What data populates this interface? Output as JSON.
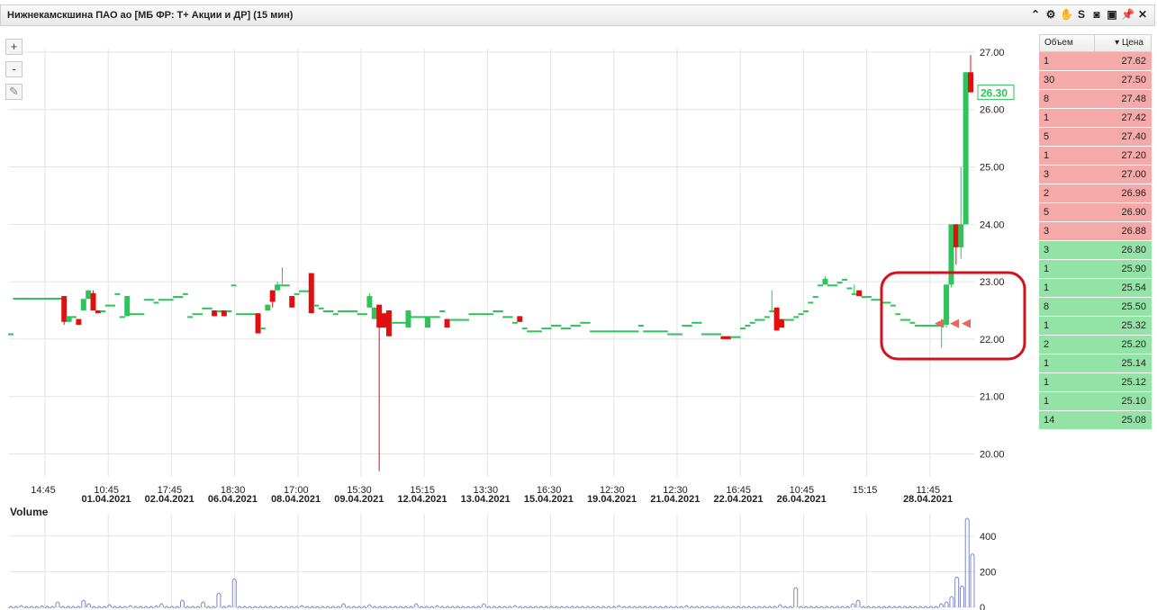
{
  "window": {
    "title": "Нижнекамскшина ПАО ао [МБ ФР: Т+ Акции и ДР] (15 мин)",
    "icons": [
      "chevron-up-icon",
      "gear-icon",
      "hand-icon",
      "s-icon",
      "camera-icon",
      "window-icon",
      "pin-icon",
      "close-icon"
    ]
  },
  "toolbar": {
    "zoom_in": "+",
    "zoom_out": "-",
    "pencil": "✎"
  },
  "chart_data": {
    "type": "candlestick",
    "title": "Нижнекамскшина ПАО ао [МБ ФР: Т+ Акции и ДР] (15 мин)",
    "ylim": [
      19.6,
      27.25
    ],
    "y_ticks": [
      "27.00",
      "26.00",
      "25.00",
      "24.00",
      "23.00",
      "22.00",
      "21.00",
      "20.00"
    ],
    "last_price": "26.30",
    "x_time_labels": [
      "14:45",
      "10:45",
      "17:45",
      "18:30",
      "17:00",
      "15:30",
      "15:15",
      "13:30",
      "16:30",
      "12:30",
      "12:30",
      "16:45",
      "10:45",
      "15:15",
      "11:45"
    ],
    "x_date_labels": [
      "01.04.2021",
      "02.04.2021",
      "06.04.2021",
      "08.04.2021",
      "09.04.2021",
      "12.04.2021",
      "13.04.2021",
      "15.04.2021",
      "19.04.2021",
      "21.04.2021",
      "22.04.2021",
      "26.04.2021",
      "28.04.2021"
    ],
    "candles_ohlc": [
      [
        22.1,
        22.1,
        22.1,
        22.1
      ],
      [
        22.7,
        22.72,
        22.7,
        22.72
      ],
      [
        22.72,
        22.72,
        22.72,
        22.72
      ],
      [
        22.72,
        22.72,
        22.72,
        22.72
      ],
      [
        22.72,
        22.72,
        22.72,
        22.72
      ],
      [
        22.72,
        22.72,
        22.72,
        22.72
      ],
      [
        22.72,
        22.72,
        22.72,
        22.72
      ],
      [
        22.72,
        22.72,
        22.72,
        22.72
      ],
      [
        22.72,
        22.72,
        22.72,
        22.72
      ],
      [
        22.72,
        22.72,
        22.72,
        22.72
      ],
      [
        22.72,
        22.72,
        22.72,
        22.72
      ],
      [
        22.75,
        22.75,
        22.25,
        22.3
      ],
      [
        22.3,
        22.4,
        22.3,
        22.4
      ],
      [
        22.4,
        22.4,
        22.4,
        22.4
      ],
      [
        22.35,
        22.35,
        22.25,
        22.25
      ],
      [
        22.5,
        22.7,
        22.5,
        22.7
      ],
      [
        22.7,
        22.85,
        22.7,
        22.85
      ],
      [
        22.8,
        22.85,
        22.5,
        22.5
      ],
      [
        22.5,
        22.5,
        22.45,
        22.45
      ],
      [
        22.5,
        22.5,
        22.5,
        22.5
      ],
      [
        22.6,
        22.6,
        22.6,
        22.6
      ],
      [
        22.6,
        22.6,
        22.6,
        22.6
      ],
      [
        22.8,
        22.8,
        22.8,
        22.8
      ],
      [
        22.4,
        22.4,
        22.4,
        22.4
      ],
      [
        22.4,
        22.75,
        22.4,
        22.75
      ],
      [
        22.45,
        22.45,
        22.45,
        22.45
      ],
      [
        22.45,
        22.45,
        22.45,
        22.45
      ],
      [
        22.45,
        22.45,
        22.45,
        22.45
      ],
      [
        22.7,
        22.7,
        22.7,
        22.7
      ],
      [
        22.7,
        22.7,
        22.7,
        22.7
      ],
      [
        22.65,
        22.65,
        22.65,
        22.65
      ],
      [
        22.7,
        22.7,
        22.7,
        22.7
      ],
      [
        22.7,
        22.7,
        22.7,
        22.7
      ],
      [
        22.7,
        22.7,
        22.7,
        22.7
      ],
      [
        22.75,
        22.75,
        22.75,
        22.75
      ],
      [
        22.75,
        22.75,
        22.75,
        22.75
      ],
      [
        22.8,
        22.8,
        22.8,
        22.8
      ],
      [
        22.4,
        22.4,
        22.4,
        22.4
      ],
      [
        22.45,
        22.45,
        22.45,
        22.45
      ],
      [
        22.45,
        22.45,
        22.45,
        22.45
      ],
      [
        22.55,
        22.55,
        22.55,
        22.55
      ],
      [
        22.55,
        22.55,
        22.55,
        22.55
      ],
      [
        22.5,
        22.5,
        22.4,
        22.4
      ],
      [
        22.5,
        22.5,
        22.5,
        22.5
      ],
      [
        22.5,
        22.5,
        22.4,
        22.4
      ],
      [
        22.5,
        22.5,
        22.5,
        22.5
      ],
      [
        22.95,
        22.95,
        22.95,
        22.95
      ],
      [
        22.45,
        22.45,
        22.45,
        22.45
      ],
      [
        22.45,
        22.45,
        22.45,
        22.45
      ],
      [
        22.45,
        22.45,
        22.45,
        22.45
      ],
      [
        22.45,
        22.45,
        22.45,
        22.45
      ],
      [
        22.45,
        22.45,
        22.1,
        22.1
      ],
      [
        22.2,
        22.2,
        22.2,
        22.2
      ],
      [
        22.5,
        22.6,
        22.5,
        22.6
      ],
      [
        22.85,
        22.85,
        22.55,
        22.65
      ],
      [
        22.85,
        23.0,
        22.85,
        22.95
      ],
      [
        22.95,
        23.25,
        22.95,
        22.95
      ],
      [
        22.95,
        22.95,
        22.95,
        22.95
      ],
      [
        22.75,
        22.75,
        22.55,
        22.55
      ],
      [
        22.8,
        22.8,
        22.8,
        22.8
      ],
      [
        22.85,
        22.85,
        22.85,
        22.85
      ],
      [
        22.85,
        22.85,
        22.85,
        22.85
      ],
      [
        23.15,
        23.15,
        22.45,
        22.45
      ],
      [
        22.6,
        22.6,
        22.6,
        22.6
      ],
      [
        22.55,
        22.55,
        22.55,
        22.55
      ],
      [
        22.5,
        22.5,
        22.5,
        22.5
      ],
      [
        22.5,
        22.5,
        22.5,
        22.5
      ],
      [
        22.45,
        22.45,
        22.45,
        22.45
      ],
      [
        22.5,
        22.5,
        22.5,
        22.5
      ],
      [
        22.5,
        22.5,
        22.5,
        22.5
      ],
      [
        22.5,
        22.5,
        22.5,
        22.5
      ],
      [
        22.5,
        22.5,
        22.5,
        22.5
      ],
      [
        22.45,
        22.45,
        22.45,
        22.45
      ],
      [
        22.45,
        22.45,
        22.45,
        22.45
      ],
      [
        22.55,
        22.8,
        22.55,
        22.75
      ],
      [
        22.35,
        22.55,
        22.35,
        22.55
      ],
      [
        22.6,
        22.6,
        19.7,
        22.2
      ],
      [
        22.45,
        22.45,
        22.2,
        22.2
      ],
      [
        22.5,
        22.5,
        22.05,
        22.05
      ],
      [
        22.3,
        22.3,
        22.3,
        22.3
      ],
      [
        22.3,
        22.3,
        22.3,
        22.3
      ],
      [
        22.3,
        22.3,
        22.3,
        22.3
      ],
      [
        22.2,
        22.5,
        22.2,
        22.5
      ],
      [
        22.4,
        22.4,
        22.4,
        22.4
      ],
      [
        22.4,
        22.4,
        22.4,
        22.4
      ],
      [
        22.4,
        22.4,
        22.4,
        22.4
      ],
      [
        22.2,
        22.4,
        22.2,
        22.4
      ],
      [
        22.4,
        22.4,
        22.4,
        22.4
      ],
      [
        22.4,
        22.4,
        22.4,
        22.4
      ],
      [
        22.5,
        22.5,
        22.5,
        22.5
      ],
      [
        22.35,
        22.35,
        22.2,
        22.2
      ],
      [
        22.35,
        22.35,
        22.35,
        22.35
      ],
      [
        22.35,
        22.35,
        22.35,
        22.35
      ],
      [
        22.35,
        22.35,
        22.35,
        22.35
      ],
      [
        22.35,
        22.35,
        22.35,
        22.35
      ],
      [
        22.45,
        22.45,
        22.45,
        22.45
      ],
      [
        22.45,
        22.45,
        22.45,
        22.45
      ],
      [
        22.45,
        22.45,
        22.45,
        22.45
      ],
      [
        22.45,
        22.45,
        22.45,
        22.45
      ],
      [
        22.45,
        22.45,
        22.45,
        22.45
      ],
      [
        22.5,
        22.5,
        22.5,
        22.5
      ],
      [
        22.5,
        22.5,
        22.5,
        22.5
      ],
      [
        22.4,
        22.4,
        22.4,
        22.4
      ],
      [
        22.4,
        22.4,
        22.4,
        22.4
      ],
      [
        22.3,
        22.3,
        22.3,
        22.3
      ],
      [
        22.4,
        22.4,
        22.3,
        22.3
      ],
      [
        22.2,
        22.2,
        22.2,
        22.2
      ],
      [
        22.15,
        22.15,
        22.15,
        22.15
      ],
      [
        22.15,
        22.15,
        22.15,
        22.15
      ],
      [
        22.15,
        22.15,
        22.15,
        22.15
      ],
      [
        22.2,
        22.2,
        22.2,
        22.2
      ],
      [
        22.2,
        22.2,
        22.2,
        22.2
      ],
      [
        22.25,
        22.25,
        22.25,
        22.25
      ],
      [
        22.25,
        22.25,
        22.25,
        22.25
      ],
      [
        22.2,
        22.2,
        22.2,
        22.2
      ],
      [
        22.2,
        22.2,
        22.2,
        22.2
      ],
      [
        22.25,
        22.25,
        22.25,
        22.25
      ],
      [
        22.25,
        22.25,
        22.25,
        22.25
      ],
      [
        22.3,
        22.3,
        22.3,
        22.3
      ],
      [
        22.3,
        22.3,
        22.3,
        22.3
      ],
      [
        22.15,
        22.15,
        22.15,
        22.15
      ],
      [
        22.15,
        22.15,
        22.15,
        22.15
      ],
      [
        22.15,
        22.15,
        22.15,
        22.15
      ],
      [
        22.15,
        22.15,
        22.15,
        22.15
      ],
      [
        22.15,
        22.15,
        22.15,
        22.15
      ],
      [
        22.15,
        22.15,
        22.15,
        22.15
      ],
      [
        22.15,
        22.15,
        22.15,
        22.15
      ],
      [
        22.15,
        22.15,
        22.15,
        22.15
      ],
      [
        22.15,
        22.15,
        22.15,
        22.15
      ],
      [
        22.15,
        22.15,
        22.15,
        22.15
      ],
      [
        22.25,
        22.25,
        22.25,
        22.25
      ],
      [
        22.15,
        22.15,
        22.15,
        22.15
      ],
      [
        22.15,
        22.15,
        22.15,
        22.15
      ],
      [
        22.15,
        22.15,
        22.15,
        22.15
      ],
      [
        22.15,
        22.15,
        22.15,
        22.15
      ],
      [
        22.15,
        22.15,
        22.15,
        22.15
      ],
      [
        22.1,
        22.1,
        22.1,
        22.1
      ],
      [
        22.1,
        22.1,
        22.1,
        22.1
      ],
      [
        22.1,
        22.1,
        22.1,
        22.1
      ],
      [
        22.25,
        22.25,
        22.25,
        22.25
      ],
      [
        22.25,
        22.25,
        22.25,
        22.25
      ],
      [
        22.3,
        22.3,
        22.3,
        22.3
      ],
      [
        22.3,
        22.3,
        22.3,
        22.3
      ],
      [
        22.1,
        22.1,
        22.1,
        22.1
      ],
      [
        22.1,
        22.1,
        22.1,
        22.1
      ],
      [
        22.1,
        22.1,
        22.1,
        22.1
      ],
      [
        22.1,
        22.1,
        22.1,
        22.1
      ],
      [
        22.05,
        22.05,
        22.0,
        22.0
      ],
      [
        22.05,
        22.05,
        22.0,
        22.0
      ],
      [
        22.05,
        22.05,
        22.05,
        22.05
      ],
      [
        22.05,
        22.05,
        22.05,
        22.05
      ],
      [
        22.2,
        22.2,
        22.2,
        22.2
      ],
      [
        22.25,
        22.25,
        22.25,
        22.25
      ],
      [
        22.3,
        22.3,
        22.3,
        22.3
      ],
      [
        22.35,
        22.35,
        22.35,
        22.35
      ],
      [
        22.35,
        22.35,
        22.35,
        22.35
      ],
      [
        22.4,
        22.4,
        22.4,
        22.4
      ],
      [
        22.5,
        22.85,
        22.5,
        22.5
      ],
      [
        22.55,
        22.55,
        22.15,
        22.15
      ],
      [
        22.35,
        22.35,
        22.2,
        22.2
      ],
      [
        22.35,
        22.35,
        22.35,
        22.35
      ],
      [
        22.35,
        22.35,
        22.35,
        22.35
      ],
      [
        22.4,
        22.4,
        22.4,
        22.4
      ],
      [
        22.45,
        22.45,
        22.45,
        22.45
      ],
      [
        22.5,
        22.5,
        22.5,
        22.5
      ],
      [
        22.65,
        22.65,
        22.65,
        22.65
      ],
      [
        22.75,
        22.75,
        22.75,
        22.75
      ],
      [
        22.95,
        22.95,
        22.95,
        22.95
      ],
      [
        22.95,
        23.1,
        22.95,
        23.05
      ],
      [
        22.95,
        22.95,
        22.95,
        22.95
      ],
      [
        22.95,
        22.95,
        22.95,
        22.95
      ],
      [
        23.0,
        23.0,
        23.0,
        23.0
      ],
      [
        23.05,
        23.05,
        23.05,
        23.05
      ],
      [
        22.9,
        22.9,
        22.9,
        22.9
      ],
      [
        22.8,
        22.95,
        22.8,
        22.8
      ],
      [
        22.85,
        22.85,
        22.75,
        22.75
      ],
      [
        22.75,
        22.75,
        22.75,
        22.75
      ],
      [
        22.75,
        22.75,
        22.75,
        22.75
      ],
      [
        22.7,
        22.7,
        22.7,
        22.7
      ],
      [
        22.7,
        22.7,
        22.7,
        22.7
      ],
      [
        22.65,
        22.65,
        22.65,
        22.65
      ],
      [
        22.65,
        22.65,
        22.65,
        22.65
      ],
      [
        22.6,
        22.6,
        22.6,
        22.6
      ],
      [
        22.45,
        22.45,
        22.45,
        22.45
      ],
      [
        22.35,
        22.35,
        22.35,
        22.35
      ],
      [
        22.35,
        22.35,
        22.35,
        22.35
      ],
      [
        22.3,
        22.3,
        22.3,
        22.3
      ],
      [
        22.25,
        22.25,
        22.25,
        22.25
      ],
      [
        22.25,
        22.25,
        22.25,
        22.25
      ],
      [
        22.25,
        22.25,
        22.25,
        22.25
      ],
      [
        22.25,
        22.25,
        22.25,
        22.25
      ],
      [
        22.25,
        22.25,
        22.25,
        22.25
      ],
      [
        22.25,
        22.35,
        21.85,
        22.25
      ],
      [
        22.25,
        22.95,
        22.2,
        22.95
      ],
      [
        22.95,
        24.0,
        22.9,
        24.0
      ],
      [
        24.0,
        24.0,
        23.3,
        23.6
      ],
      [
        23.6,
        25.0,
        23.4,
        24.0
      ],
      [
        24.0,
        26.65,
        24.0,
        26.65
      ],
      [
        26.65,
        26.95,
        26.3,
        26.3
      ]
    ],
    "volume_panel": {
      "title": "Volume",
      "y_ticks": [
        "400",
        "200",
        "0"
      ],
      "ylim": [
        0,
        500
      ]
    },
    "volumes": [
      5,
      5,
      10,
      5,
      5,
      5,
      8,
      5,
      5,
      30,
      5,
      5,
      5,
      5,
      40,
      20,
      5,
      5,
      5,
      15,
      5,
      5,
      5,
      10,
      5,
      5,
      5,
      5,
      8,
      20,
      5,
      5,
      5,
      40,
      5,
      5,
      5,
      30,
      5,
      5,
      80,
      5,
      10,
      160,
      5,
      5,
      5,
      5,
      5,
      5,
      5,
      5,
      5,
      5,
      5,
      5,
      10,
      5,
      5,
      5,
      5,
      5,
      5,
      5,
      20,
      5,
      5,
      5,
      5,
      15,
      5,
      5,
      5,
      5,
      5,
      5,
      5,
      5,
      20,
      5,
      5,
      5,
      10,
      5,
      5,
      5,
      5,
      5,
      5,
      5,
      5,
      20,
      5,
      5,
      5,
      5,
      5,
      10,
      5,
      5,
      5,
      5,
      5,
      5,
      5,
      5,
      5,
      5,
      5,
      5,
      5,
      5,
      5,
      5,
      5,
      5,
      5,
      10,
      5,
      5,
      5,
      5,
      5,
      5,
      5,
      5,
      5,
      5,
      5,
      5,
      10,
      5,
      5,
      5,
      5,
      5,
      5,
      5,
      5,
      5,
      5,
      5,
      5,
      5,
      5,
      5,
      5,
      5,
      15,
      5,
      5,
      110,
      5,
      5,
      5,
      5,
      5,
      5,
      5,
      5,
      5,
      5,
      20,
      40,
      5,
      5,
      5,
      5,
      5,
      5,
      5,
      5,
      5,
      5,
      5,
      5,
      5,
      5,
      5,
      20,
      30,
      60,
      170,
      120,
      500,
      300
    ]
  },
  "order_book": {
    "header": {
      "volume": "Объем",
      "price": "Цена"
    },
    "asks": [
      {
        "volume": "1",
        "price": "27.62"
      },
      {
        "volume": "30",
        "price": "27.50"
      },
      {
        "volume": "8",
        "price": "27.48"
      },
      {
        "volume": "1",
        "price": "27.42"
      },
      {
        "volume": "5",
        "price": "27.40"
      },
      {
        "volume": "1",
        "price": "27.20"
      },
      {
        "volume": "3",
        "price": "27.00"
      },
      {
        "volume": "2",
        "price": "26.96"
      },
      {
        "volume": "5",
        "price": "26.90"
      },
      {
        "volume": "3",
        "price": "26.88"
      }
    ],
    "bids": [
      {
        "volume": "3",
        "price": "26.80"
      },
      {
        "volume": "1",
        "price": "25.90"
      },
      {
        "volume": "1",
        "price": "25.54"
      },
      {
        "volume": "8",
        "price": "25.50"
      },
      {
        "volume": "1",
        "price": "25.32"
      },
      {
        "volume": "2",
        "price": "25.20"
      },
      {
        "volume": "1",
        "price": "25.14"
      },
      {
        "volume": "1",
        "price": "25.12"
      },
      {
        "volume": "1",
        "price": "25.10"
      },
      {
        "volume": "14",
        "price": "25.08"
      }
    ]
  },
  "colors": {
    "up": "#2ec35b",
    "down": "#e01010",
    "grid": "#e3e3e3",
    "highlight": "#d0131d",
    "volume": "#7f87c9"
  }
}
